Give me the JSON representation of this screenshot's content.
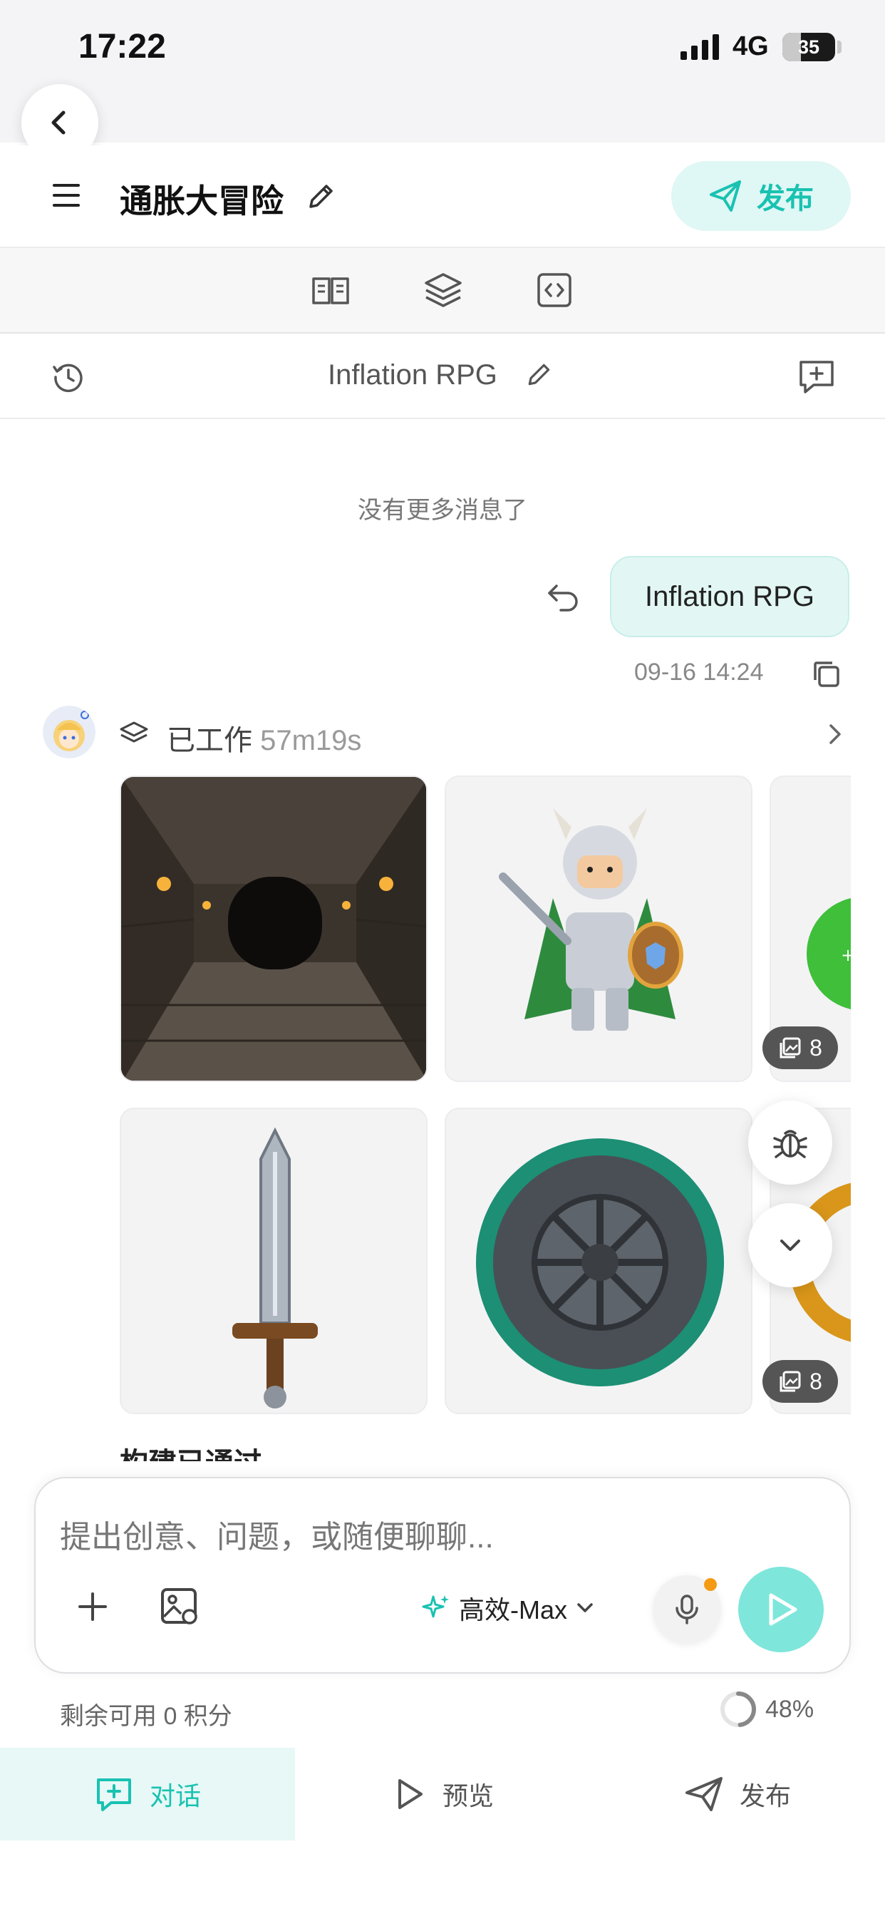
{
  "status_bar": {
    "time": "17:22",
    "network": "4G",
    "battery": "35",
    "battery_level": 0.35
  },
  "header": {
    "title": "通胀大冒险",
    "publish_label": "发布"
  },
  "toolbar": {
    "icons": [
      "book-icon",
      "layers-icon",
      "code-icon"
    ]
  },
  "conversation": {
    "title": "Inflation RPG"
  },
  "messages": {
    "no_more": "没有更多消息了",
    "user_text": "Inflation RPG",
    "user_time": "09-16 14:24",
    "worked_label": "已工作",
    "worked_duration": "57m19s",
    "image_count_row1": "8",
    "image_count_row2": "8",
    "cut_text": "构建已通过"
  },
  "composer": {
    "placeholder": "提出创意、问题，或随便聊聊...",
    "model": "高效-Max"
  },
  "footer": {
    "credits": "剩余可用 0 积分",
    "usage": "48%",
    "usage_fraction": 0.48
  },
  "nav": {
    "chat": "对话",
    "preview": "预览",
    "publish": "发布"
  },
  "colors": {
    "accent": "#19c2b1",
    "accent_light": "#dff7f5",
    "send": "#7fe6db"
  }
}
